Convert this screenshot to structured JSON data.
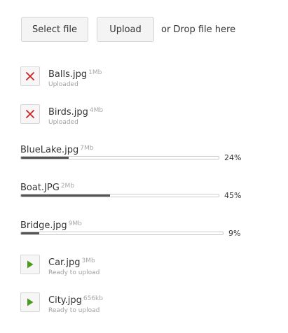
{
  "toolbar": {
    "select_label": "Select file",
    "upload_label": "Upload",
    "drop_text": "or Drop file here"
  },
  "files": [
    {
      "name": "Balls.jpg",
      "size": "1Mb",
      "status": "Uploaded",
      "action_icon": "close-icon",
      "icon_color": "#cc2222"
    },
    {
      "name": "Birds.jpg",
      "size": "4Mb",
      "status": "Uploaded",
      "action_icon": "close-icon",
      "icon_color": "#cc2222"
    },
    {
      "name": "BlueLake.jpg",
      "size": "7Mb",
      "progress": 24,
      "progress_label": "24%"
    },
    {
      "name": "Boat.JPG",
      "size": "2Mb",
      "progress": 45,
      "progress_label": "45%"
    },
    {
      "name": "Bridge.jpg",
      "size": "9Mb",
      "progress": 9,
      "progress_label": "9%"
    },
    {
      "name": "Car.jpg",
      "size": "3Mb",
      "status": "Ready to upload",
      "action_icon": "play-icon",
      "icon_color": "#4a9a1e"
    },
    {
      "name": "City.jpg",
      "size": "656kb",
      "status": "Ready to upload",
      "action_icon": "play-icon",
      "icon_color": "#4a9a1e"
    }
  ]
}
